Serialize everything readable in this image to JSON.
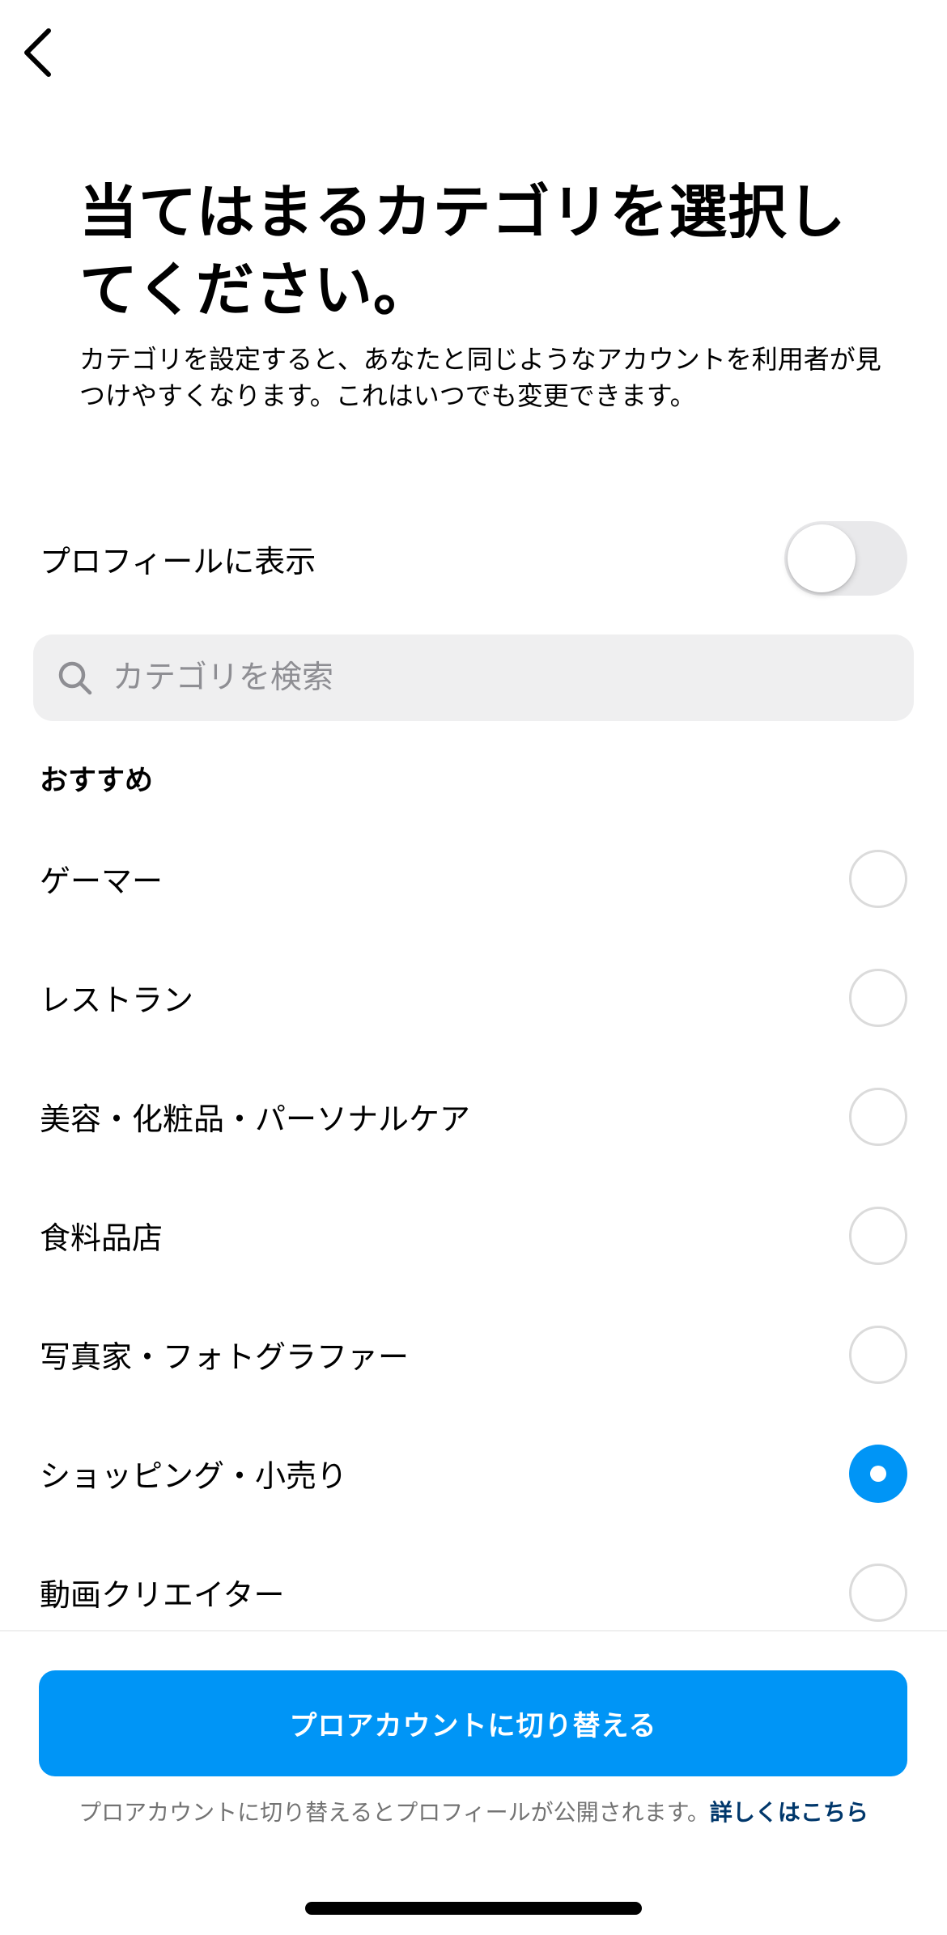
{
  "header": {
    "back_icon": "chevron-left-icon",
    "title": "当てはまるカテゴリを選択してください。",
    "subtitle": "カテゴリを設定すると、あなたと同じようなアカウントを利用者が見つけやすくなります。これはいつでも変更できます。"
  },
  "display_toggle": {
    "label": "プロフィールに表示",
    "on": false
  },
  "search": {
    "icon": "search-icon",
    "placeholder": "カテゴリを検索",
    "value": ""
  },
  "suggested": {
    "header": "おすすめ",
    "items": [
      {
        "label": "ゲーマー",
        "selected": false
      },
      {
        "label": "レストラン",
        "selected": false
      },
      {
        "label": "美容・化粧品・パーソナルケア",
        "selected": false
      },
      {
        "label": "食料品店",
        "selected": false
      },
      {
        "label": "写真家・フォトグラファー",
        "selected": false
      },
      {
        "label": "ショッピング・小売り",
        "selected": true
      },
      {
        "label": "動画クリエイター",
        "selected": false
      }
    ]
  },
  "footer": {
    "button_label": "プロアカウントに切り替える",
    "note": "プロアカウントに切り替えるとプロフィールが公開されます。",
    "link": "詳しくはこちら"
  },
  "colors": {
    "accent": "#0095f6",
    "link": "#00376b",
    "muted": "#737373",
    "search_bg": "#efeff0"
  }
}
